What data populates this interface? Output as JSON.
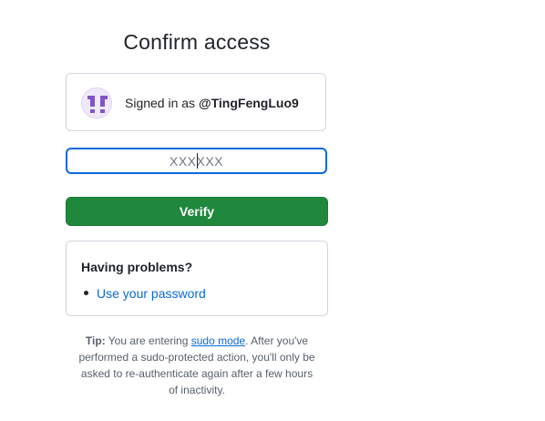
{
  "page": {
    "title": "Confirm access"
  },
  "account": {
    "signed_in_prefix": "Signed in as ",
    "username": "@TingFengLuo9",
    "avatar_icon": "identicon-avatar"
  },
  "form": {
    "otp_placeholder": "XXXXXX",
    "otp_value": "",
    "verify_label": "Verify"
  },
  "problems": {
    "heading": "Having problems?",
    "links": [
      {
        "label": "Use your password"
      }
    ]
  },
  "tip": {
    "label": "Tip:",
    "text_before_link": " You are entering ",
    "link_label": "sudo mode",
    "text_after_link": ". After you've performed a sudo-protected action, you'll only be asked to re-authenticate again after a few hours of inactivity."
  },
  "colors": {
    "accent": "#0969da",
    "verify_green": "#1f883d",
    "avatar_purple": "#7f55c7",
    "border": "#d0d7de"
  }
}
